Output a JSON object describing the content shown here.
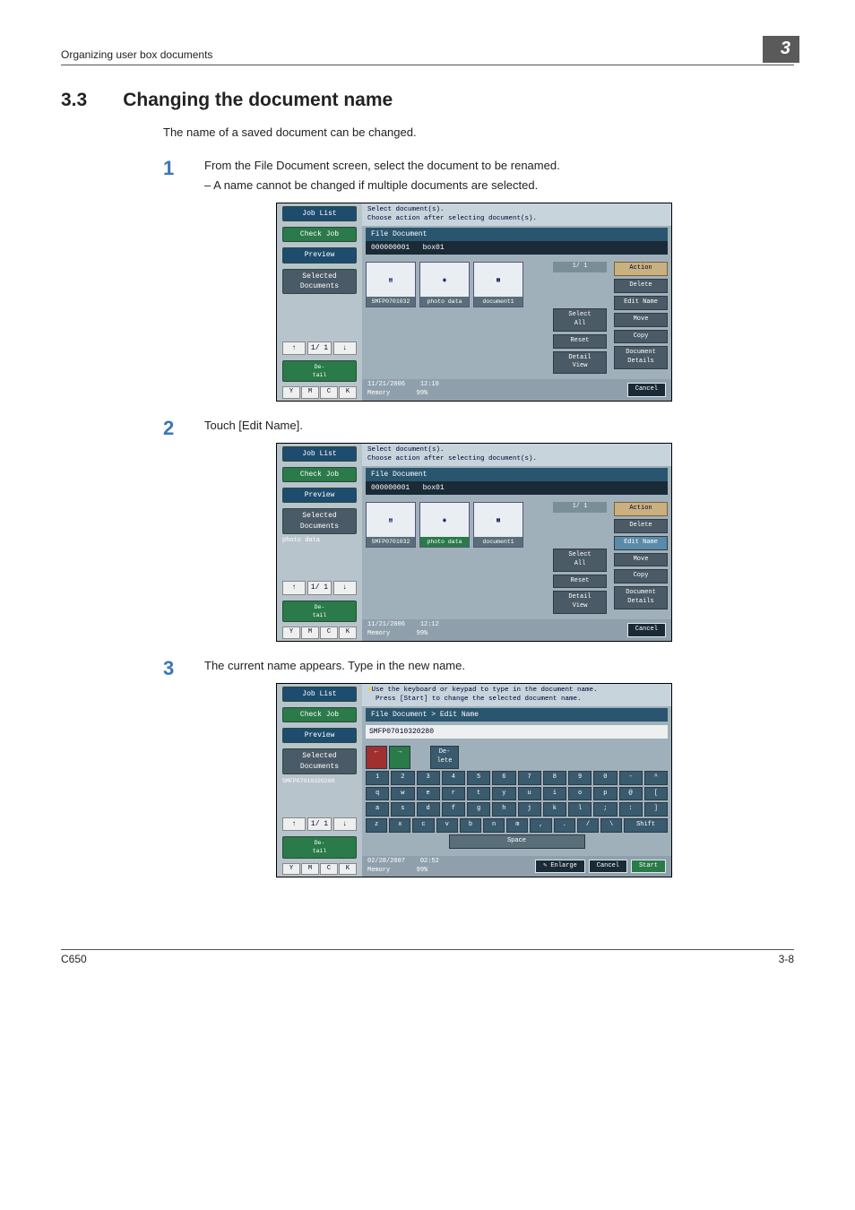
{
  "header": {
    "left": "Organizing user box documents",
    "chapter": "3"
  },
  "section": {
    "number": "3.3",
    "title": "Changing the document name",
    "intro": "The name of a saved document can be changed."
  },
  "steps": [
    {
      "num": "1",
      "text": "From the File Document screen, select the document to be renamed.",
      "sub": "A name cannot be changed if multiple documents are selected."
    },
    {
      "num": "2",
      "text": "Touch [Edit Name]."
    },
    {
      "num": "3",
      "text": "The current name appears. Type in the new name."
    }
  ],
  "screen": {
    "sidebar": {
      "jobList": "Job List",
      "checkJob": "Check Job",
      "preview": "Preview",
      "selectedDocs": "Selected Documents",
      "nav": "1/  1",
      "detail": "De-\ntail",
      "ymck": [
        "Y",
        "M",
        "C",
        "K"
      ]
    },
    "header1": "Select document(s).\nChoose action after selecting document(s).",
    "header3a": "Use the keyboard or keypad to type in the document name.",
    "header3b": "Press [Start] to change the selected document name.",
    "fileDoc": "File Document",
    "fileDocEdit": "File Document > Edit Name",
    "boxId": "000000001",
    "boxName": "box01",
    "thumbs": [
      "SMFP0701032",
      "photo data",
      "document1"
    ],
    "page": "1/  1",
    "selectAll": "Select\nAll",
    "reset": "Reset",
    "detailView": "Detail\nView",
    "actions": {
      "label": "Action",
      "delete": "Delete",
      "edit": "Edit Name",
      "move": "Move",
      "copy": "Copy",
      "docDetails": "Document\nDetails"
    },
    "cancel": "Cancel",
    "start": "Start",
    "enlarge": "Enlarge",
    "status1": {
      "date": "11/21/2006",
      "time": "12:10",
      "memLbl": "Memory",
      "mem": "99%"
    },
    "status2": {
      "date": "11/21/2006",
      "time": "12:12",
      "memLbl": "Memory",
      "mem": "99%"
    },
    "status3": {
      "date": "02/28/2007",
      "time": "02:52",
      "memLbl": "Memory",
      "mem": "99%"
    },
    "selectedItem2": "photo data",
    "selectedItem3": "SMFP07010320280",
    "input3": "SMFP07010320280",
    "kbd": {
      "topCtl": [
        "←",
        "→",
        "De-\nlete"
      ],
      "r1": [
        "1",
        "2",
        "3",
        "4",
        "5",
        "6",
        "7",
        "8",
        "9",
        "0",
        "-",
        "^"
      ],
      "r2": [
        "q",
        "w",
        "e",
        "r",
        "t",
        "y",
        "u",
        "i",
        "o",
        "p",
        "@",
        "["
      ],
      "r3": [
        "a",
        "s",
        "d",
        "f",
        "g",
        "h",
        "j",
        "k",
        "l",
        ";",
        ":",
        "]"
      ],
      "r4": [
        "z",
        "x",
        "c",
        "v",
        "b",
        "n",
        "m",
        ",",
        ".",
        "/",
        "\\"
      ],
      "shift": "Shift",
      "space": "Space"
    }
  },
  "footer": {
    "left": "C650",
    "right": "3-8"
  }
}
